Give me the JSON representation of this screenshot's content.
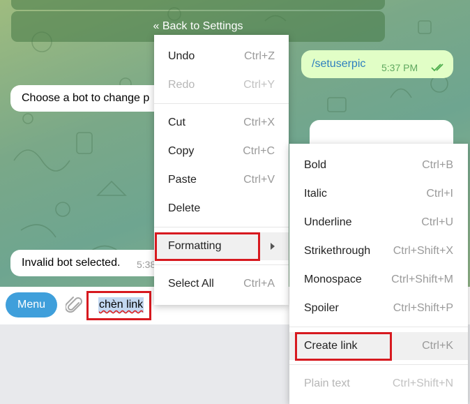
{
  "chat": {
    "keyboard_button": "« Back to Settings",
    "messages": [
      {
        "text": "/setuserpic",
        "time": "5:37 PM",
        "status": "read"
      },
      {
        "text": "Choose a bot to change p"
      },
      {
        "text": "Invalid bot selected.",
        "time": "5:38"
      }
    ]
  },
  "input": {
    "menu_label": "Menu",
    "attach_icon": "paperclip-icon",
    "text": "chèn link"
  },
  "context_menu": {
    "items": [
      {
        "label": "Undo",
        "shortcut": "Ctrl+Z",
        "enabled": true
      },
      {
        "label": "Redo",
        "shortcut": "Ctrl+Y",
        "enabled": false
      },
      {
        "label": "Cut",
        "shortcut": "Ctrl+X",
        "enabled": true
      },
      {
        "label": "Copy",
        "shortcut": "Ctrl+C",
        "enabled": true
      },
      {
        "label": "Paste",
        "shortcut": "Ctrl+V",
        "enabled": true
      },
      {
        "label": "Delete",
        "shortcut": "",
        "enabled": true
      },
      {
        "label": "Formatting",
        "shortcut": "",
        "enabled": true,
        "submenu": true
      },
      {
        "label": "Select All",
        "shortcut": "Ctrl+A",
        "enabled": true
      }
    ]
  },
  "formatting_menu": {
    "items": [
      {
        "label": "Bold",
        "shortcut": "Ctrl+B",
        "enabled": true
      },
      {
        "label": "Italic",
        "shortcut": "Ctrl+I",
        "enabled": true
      },
      {
        "label": "Underline",
        "shortcut": "Ctrl+U",
        "enabled": true
      },
      {
        "label": "Strikethrough",
        "shortcut": "Ctrl+Shift+X",
        "enabled": true
      },
      {
        "label": "Monospace",
        "shortcut": "Ctrl+Shift+M",
        "enabled": true
      },
      {
        "label": "Spoiler",
        "shortcut": "Ctrl+Shift+P",
        "enabled": true
      },
      {
        "label": "Create link",
        "shortcut": "Ctrl+K",
        "enabled": true
      },
      {
        "label": "Plain text",
        "shortcut": "Ctrl+Shift+N",
        "enabled": false
      }
    ]
  },
  "colors": {
    "menu_button": "#3f9fdb",
    "highlight_box": "#d7191f",
    "outgoing_bubble": "#e1fec6",
    "read_check": "#4fae4e"
  }
}
